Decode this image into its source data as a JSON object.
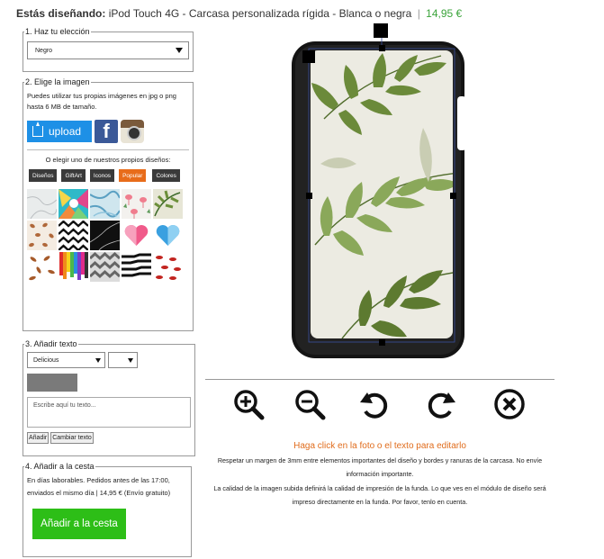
{
  "header": {
    "label": "Estás diseñando:",
    "product": "iPod Touch 4G - Carcasa personalizada rígida - Blanca o negra",
    "separator": "|",
    "price": "14,95 €"
  },
  "step1": {
    "legend": "1. Haz tu elección",
    "selected": "Negro"
  },
  "step2": {
    "legend": "2. Elige la imagen",
    "description": "Puedes utilizar tus propias imágenes en jpg o png hasta 6 MB de tamaño.",
    "upload_label": "upload",
    "facebook_letter": "f",
    "or_text": "O elegir uno de nuestros propios diseños:",
    "tabs": [
      "Diseños",
      "GiftArt",
      "Iconos",
      "Popular",
      "Colores"
    ],
    "thumb_names": [
      "marble-white",
      "tropical-abstract",
      "blue-marble",
      "flamingos",
      "palm-leaves",
      "brown-pattern",
      "chevron-bw",
      "black-marble",
      "pink-heart",
      "blue-heart",
      "feathers",
      "colored-drips",
      "chevron-grey",
      "zebra-stripes",
      "red-lips"
    ]
  },
  "step3": {
    "legend": "3. Añadir texto",
    "font": "Delicious",
    "size": "",
    "placeholder": "Escribe aquí tu texto...",
    "add_button": "Añadir",
    "change_button": "Cambiar texto"
  },
  "step4": {
    "legend": "4. Añadir a la cesta",
    "line1": "En días laborables. Pedidos antes de las 17:00,",
    "line2": "enviados el mismo día | 14,95 € (Envío gratuito)",
    "button": "Añadir a la cesta"
  },
  "tools": [
    "zoom-in-icon",
    "zoom-out-icon",
    "rotate-left-icon",
    "rotate-right-icon",
    "delete-icon"
  ],
  "hints": {
    "click": "Haga click en la foto o el texto para editarlo",
    "note1": "Respetar un margen de 3mm entre elementos importantes del diseño y bordes y ranuras de la carcasa. No envíe información importante.",
    "note2": "La calidad de la imagen subida definirá la calidad de impresión de la funda. Lo que ves en el módulo de diseño será impreso directamente en la funda. Por favor, tenlo en cuenta."
  },
  "colors": {
    "accent_orange": "#e86c1a",
    "price_green": "#3aa33a",
    "upload_blue": "#1e90e6",
    "cart_green": "#2dbe17"
  }
}
